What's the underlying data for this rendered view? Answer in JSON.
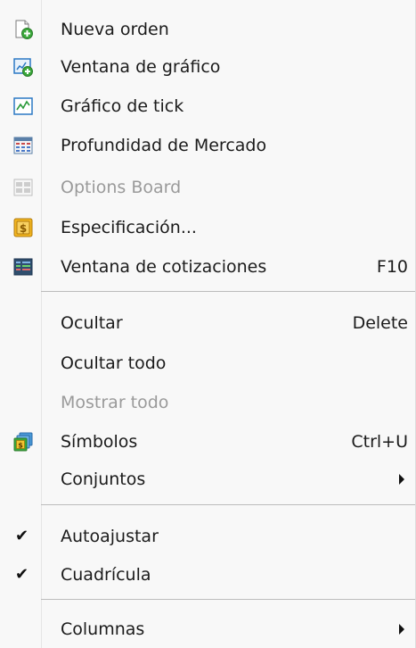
{
  "menu": {
    "group1": [
      {
        "label": "Nueva orden",
        "shortcut": "",
        "icon": "new-order-icon",
        "enabled": true
      },
      {
        "label": "Ventana de gráfico",
        "shortcut": "",
        "icon": "chart-window-icon",
        "enabled": true
      },
      {
        "label": "Gráfico de tick",
        "shortcut": "",
        "icon": "tick-chart-icon",
        "enabled": true
      },
      {
        "label": "Profundidad de Mercado",
        "shortcut": "",
        "icon": "market-depth-icon",
        "enabled": true
      },
      {
        "label": "Options Board",
        "shortcut": "",
        "icon": "options-board-icon",
        "enabled": false
      },
      {
        "label": "Especificación...",
        "shortcut": "",
        "icon": "dollar-icon",
        "enabled": true
      },
      {
        "label": "Ventana de cotizaciones",
        "shortcut": "F10",
        "icon": "quotes-window-icon",
        "enabled": true
      }
    ],
    "group2": [
      {
        "label": "Ocultar",
        "shortcut": "Delete",
        "enabled": true
      },
      {
        "label": "Ocultar todo",
        "shortcut": "",
        "enabled": true
      },
      {
        "label": "Mostrar todo",
        "shortcut": "",
        "enabled": false
      },
      {
        "label": "Símbolos",
        "shortcut": "Ctrl+U",
        "icon": "symbols-icon",
        "enabled": true
      },
      {
        "label": "Conjuntos",
        "shortcut": "",
        "submenu": true,
        "enabled": true
      }
    ],
    "group3": [
      {
        "label": "Autoajustar",
        "checked": true,
        "enabled": true
      },
      {
        "label": "Cuadrícula",
        "checked": true,
        "enabled": true
      }
    ],
    "group4": [
      {
        "label": "Columnas",
        "submenu": true,
        "enabled": true
      }
    ],
    "check_glyph": "✔"
  },
  "colors": {
    "menu_background": "#f8f8f8",
    "separator": "#bcbcbc",
    "disabled_text": "#9a9a9a",
    "icon_green": "#3aa83a",
    "icon_blue": "#2a78c4",
    "icon_gold": "#e0a81a"
  }
}
